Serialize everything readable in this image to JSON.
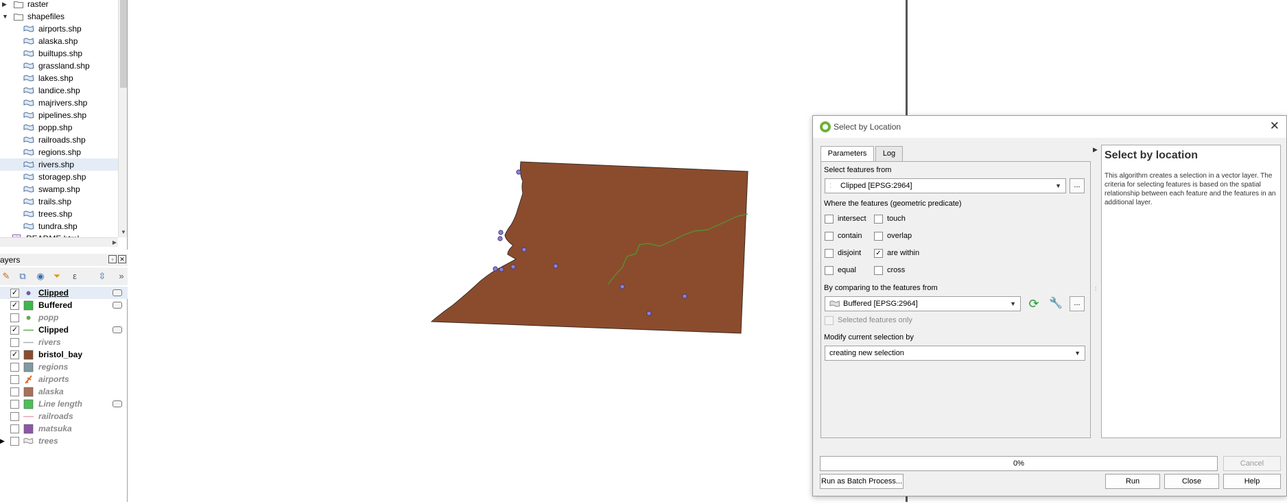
{
  "browser": {
    "folders": [
      "raster",
      "shapefiles"
    ],
    "files": [
      "airports.shp",
      "alaska.shp",
      "builtups.shp",
      "grassland.shp",
      "lakes.shp",
      "landice.shp",
      "majrivers.shp",
      "pipelines.shp",
      "popp.shp",
      "railroads.shp",
      "regions.shp",
      "rivers.shp",
      "storagep.shp",
      "swamp.shp",
      "trails.shp",
      "trees.shp",
      "tundra.shp"
    ],
    "readme": "README.html",
    "selected": "rivers.shp"
  },
  "layers_panel": {
    "title": "ayers",
    "items": [
      {
        "name": "Clipped",
        "checked": true,
        "kind": "point",
        "color": "#6b5aa8",
        "filter": true
      },
      {
        "name": "Buffered",
        "checked": true,
        "kind": "fill",
        "color": "#3cb84a",
        "filter": true
      },
      {
        "name": "popp",
        "checked": false,
        "kind": "point",
        "color": "#6aa84f",
        "filter": false
      },
      {
        "name": "Clipped",
        "checked": true,
        "kind": "line",
        "color": "#5fae4a",
        "filter": true
      },
      {
        "name": "rivers",
        "checked": false,
        "kind": "line",
        "color": "#b0b0b0",
        "filter": false
      },
      {
        "name": "bristol_bay",
        "checked": true,
        "kind": "fill",
        "color": "#8b4c2e",
        "filter": false
      },
      {
        "name": "regions",
        "checked": false,
        "kind": "fill",
        "color": "#7f9aa0",
        "filter": false
      },
      {
        "name": "airports",
        "checked": false,
        "kind": "icon",
        "color": "#e06a2a",
        "filter": false
      },
      {
        "name": "alaska",
        "checked": false,
        "kind": "fill",
        "color": "#a9715a",
        "filter": false
      },
      {
        "name": "Line length",
        "checked": false,
        "kind": "fill",
        "color": "#4cc058",
        "filter": true
      },
      {
        "name": "railroads",
        "checked": false,
        "kind": "line",
        "color": "#e8a0b4",
        "filter": false
      },
      {
        "name": "matsuka",
        "checked": false,
        "kind": "fill",
        "color": "#8e56a8",
        "filter": false
      },
      {
        "name": "trees",
        "checked": false,
        "kind": "shp",
        "color": "#888888",
        "filter": false
      }
    ]
  },
  "map": {
    "polygon_color": "#8b4c2e",
    "river_color": "#4e9a2f",
    "point_color": "#8b7fd0"
  },
  "dialog": {
    "title": "Select by Location",
    "tabs": [
      "Parameters",
      "Log"
    ],
    "select_from_label": "Select features from",
    "select_from_value": "Clipped [EPSG:2964]",
    "predicate_label": "Where the features (geometric predicate)",
    "predicates": [
      {
        "label": "intersect",
        "checked": false
      },
      {
        "label": "touch",
        "checked": false
      },
      {
        "label": "contain",
        "checked": false
      },
      {
        "label": "overlap",
        "checked": false
      },
      {
        "label": "disjoint",
        "checked": false
      },
      {
        "label": "are within",
        "checked": true
      },
      {
        "label": "equal",
        "checked": false
      },
      {
        "label": "cross",
        "checked": false
      }
    ],
    "compare_label": "By comparing to the features from",
    "compare_value": "Buffered [EPSG:2964]",
    "selected_only_label": "Selected features only",
    "modify_label": "Modify current selection by",
    "modify_value": "creating new selection",
    "ellipsis": "...",
    "help_title": "Select by location",
    "help_text": "This algorithm creates a selection in a vector layer. The criteria for selecting features is based on the spatial relationship between each feature and the features in an additional layer.",
    "progress": "0%",
    "progress_value": 0,
    "buttons": {
      "cancel": "Cancel",
      "batch": "Run as Batch Process...",
      "run": "Run",
      "close": "Close",
      "help": "Help"
    }
  }
}
